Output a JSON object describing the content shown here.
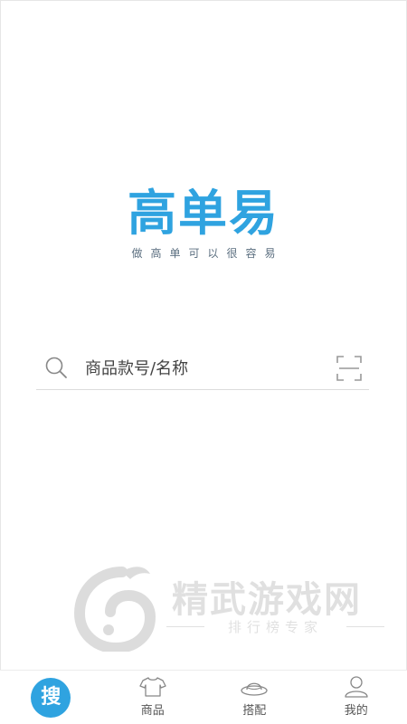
{
  "logo": {
    "title": "高单易",
    "tagline": "做高单可以很容易",
    "color": "#2fa3e0"
  },
  "search": {
    "placeholder": "商品款号/名称",
    "search_icon": "search-icon",
    "scan_icon": "scan-icon"
  },
  "watermark": {
    "title": "精武游戏网",
    "subtitle": "排行榜专家"
  },
  "tabbar": {
    "tabs": [
      {
        "label": "搜",
        "icon": "search-badge",
        "active": true
      },
      {
        "label": "商品",
        "icon": "tshirt-icon"
      },
      {
        "label": "搭配",
        "icon": "hat-icon"
      },
      {
        "label": "我的",
        "icon": "person-icon"
      }
    ]
  }
}
